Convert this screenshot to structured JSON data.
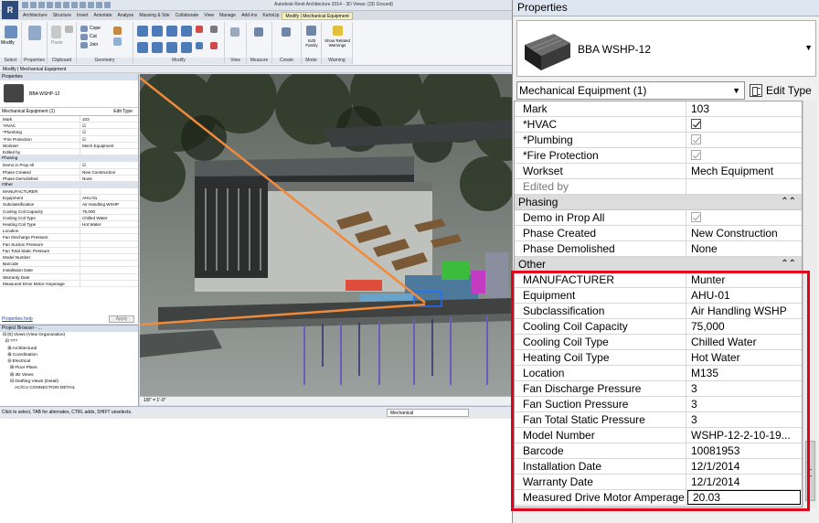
{
  "revit": {
    "app_title": "Autodesk Revit Architecture 2014 - 3D Views: {3D Ground}",
    "tabs": [
      "Architecture",
      "Structure",
      "Insert",
      "Annotate",
      "Analyze",
      "Massing & Site",
      "Collaborate",
      "View",
      "Manage",
      "Add-Ins",
      "KartsUp",
      "Modify | Mechanical Equipment"
    ],
    "panels": {
      "select": "Select",
      "properties": "Properties",
      "clipboard": "Clipboard",
      "geometry": "Geometry",
      "modify": "Modify",
      "view": "View",
      "measure": "Measure",
      "create": "Create",
      "mode": "Mode",
      "warning": "Warning",
      "modify_btn": "Modify",
      "paste_btn": "Paste",
      "cope_btn": "Cope",
      "cut_btn": "Cut",
      "join_btn": "Join",
      "edit_family_btn": "Edit Family",
      "show_warnings_btn": "Show Related Warnings"
    },
    "context_bar": "Modify | Mechanical Equipment",
    "mini_properties": {
      "header": "Properties",
      "type_name": "BBA WSHP-12",
      "selector": "Mechanical Equipment (1)",
      "edit_type": "Edit Type",
      "rows": [
        {
          "k": "Mark",
          "v": "103"
        },
        {
          "k": "*HVAC",
          "v": "☑"
        },
        {
          "k": "*Plumbing",
          "v": "☑"
        },
        {
          "k": "*Fire Protection",
          "v": "☑"
        },
        {
          "k": "Workset",
          "v": "Mech Equipment"
        },
        {
          "k": "Edited by",
          "v": ""
        }
      ],
      "phasing_label": "Phasing",
      "phasing_rows": [
        {
          "k": "Demo in Prop All",
          "v": "☑"
        },
        {
          "k": "Phase Created",
          "v": "New Construction"
        },
        {
          "k": "Phase Demolished",
          "v": "None"
        }
      ],
      "other_label": "Other",
      "other_rows": [
        {
          "k": "MANUFACTURER",
          "v": ""
        },
        {
          "k": "Equipment",
          "v": "AHU-01"
        },
        {
          "k": "Subclassification",
          "v": "Air Handling WSHP"
        },
        {
          "k": "Cooling Coil Capacity",
          "v": "75,000"
        },
        {
          "k": "Cooling Coil Type",
          "v": "Chilled Water"
        },
        {
          "k": "Heating Coil Type",
          "v": "Hot Water"
        },
        {
          "k": "Location",
          "v": ""
        },
        {
          "k": "Fan Discharge Pressure",
          "v": ""
        },
        {
          "k": "Fan Suction Pressure",
          "v": ""
        },
        {
          "k": "Fan Total Static Pressure",
          "v": ""
        },
        {
          "k": "Model Number",
          "v": ""
        },
        {
          "k": "Barcode",
          "v": ""
        },
        {
          "k": "Installation Date",
          "v": ""
        },
        {
          "k": "Warranty Date",
          "v": ""
        },
        {
          "k": "Measured Drive Motor Amperage",
          "v": ""
        }
      ],
      "help": "Properties help",
      "apply": "Apply"
    },
    "project_browser": {
      "header": "Project Browser - ...",
      "items": [
        "⊟ [0] Views (View Organization)",
        "  ⊟ ???",
        "    ⊞ Architectural",
        "    ⊞ Coordination",
        "    ⊟ Electrical",
        "      ⊞ Floor Plans",
        "      ⊞ 3D Views",
        "      ⊟ Drafting Views (Detail)",
        "          AC/CU CONNECTION DETAIL"
      ]
    },
    "view_scale": "1/8\" = 1'-0\"",
    "status_text": "Click to select, TAB for alternates, CTRL adds, SHIFT unselects.",
    "status_workset": "Mechanical"
  },
  "properties": {
    "header": "Properties",
    "type_name": "BBA WSHP-12",
    "instance_selector": "Mechanical Equipment (1)",
    "edit_type": "Edit Type",
    "identity_rows": [
      {
        "key": "Mark",
        "value": "103",
        "kind": "text"
      },
      {
        "key": "*HVAC",
        "value": "checked",
        "kind": "check"
      },
      {
        "key": "*Plumbing",
        "value": "checked-gray",
        "kind": "check"
      },
      {
        "key": "*Fire Protection",
        "value": "checked-gray",
        "kind": "check"
      },
      {
        "key": "Workset",
        "value": "Mech Equipment",
        "kind": "text"
      },
      {
        "key": "Edited by",
        "value": "",
        "kind": "dim"
      }
    ],
    "phasing_label": "Phasing",
    "phasing_rows": [
      {
        "key": "Demo in Prop All",
        "value": "checked-gray",
        "kind": "check"
      },
      {
        "key": "Phase Created",
        "value": "New Construction",
        "kind": "text"
      },
      {
        "key": "Phase Demolished",
        "value": "None",
        "kind": "text"
      }
    ],
    "other_label": "Other",
    "other_rows": [
      {
        "key": "MANUFACTURER",
        "value": "Munter"
      },
      {
        "key": "Equipment",
        "value": "AHU-01"
      },
      {
        "key": "Subclassification",
        "value": "Air Handling WSHP"
      },
      {
        "key": "Cooling Coil Capacity",
        "value": "75,000"
      },
      {
        "key": "Cooling Coil Type",
        "value": "Chilled Water"
      },
      {
        "key": "Heating Coil Type",
        "value": "Hot Water"
      },
      {
        "key": "Location",
        "value": "M135"
      },
      {
        "key": "Fan Discharge Pressure",
        "value": "3"
      },
      {
        "key": "Fan Suction Pressure",
        "value": "3"
      },
      {
        "key": "Fan Total Static Pressure",
        "value": "3"
      },
      {
        "key": "Model Number",
        "value": "WSHP-12-2-10-19..."
      },
      {
        "key": "Barcode",
        "value": "10081953"
      },
      {
        "key": "Installation Date",
        "value": "12/1/2014"
      },
      {
        "key": "Warranty Date",
        "value": "12/1/2014"
      },
      {
        "key": "Measured Drive Motor Amperage",
        "value": "20.03"
      }
    ]
  },
  "colors": {
    "highlight": "#e2001a",
    "callout": "#f08a3c"
  },
  "icons": {
    "collapse": "chevron-double-up-icon",
    "dropdown": "chevron-down-icon",
    "edit_type": "edit-type-icon"
  }
}
